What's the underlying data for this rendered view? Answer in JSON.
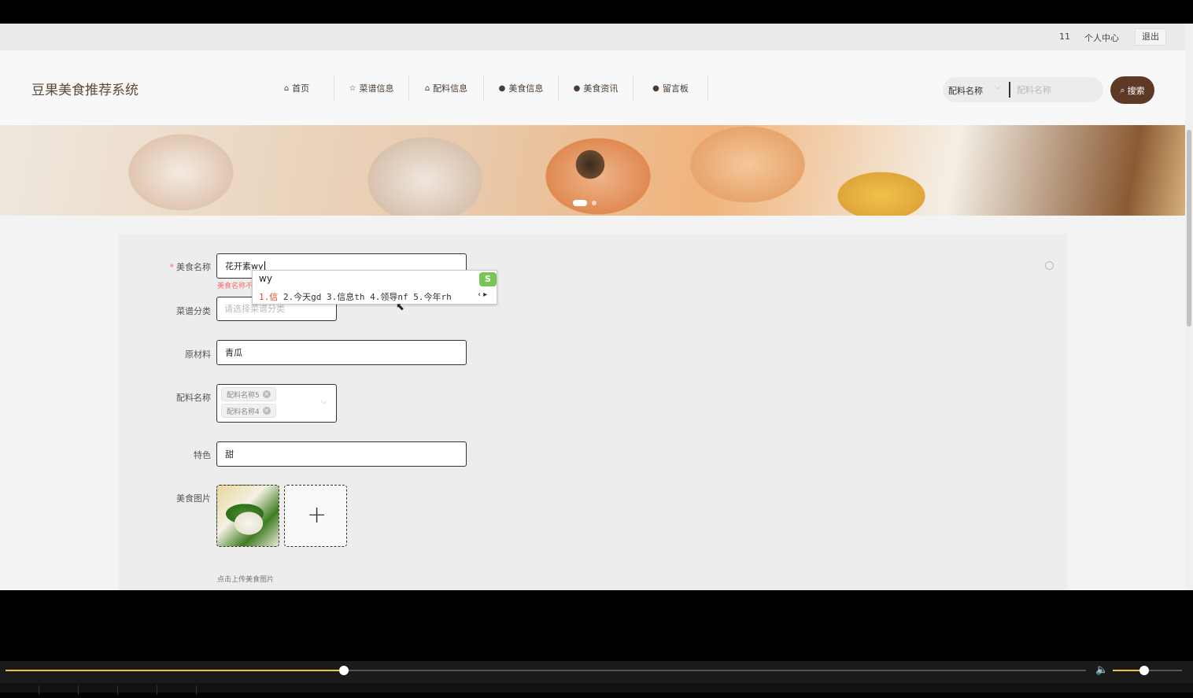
{
  "topbar": {
    "user": "11",
    "profile": "个人中心",
    "logout": "退出"
  },
  "brand": "豆果美食推荐系统",
  "nav": [
    {
      "icon": "⌂",
      "label": "首页"
    },
    {
      "icon": "☆",
      "label": "菜谱信息"
    },
    {
      "icon": "⌂",
      "label": "配料信息"
    },
    {
      "icon": "●",
      "label": "美食信息"
    },
    {
      "icon": "●",
      "label": "美食资讯"
    },
    {
      "icon": "●",
      "label": "留言板"
    }
  ],
  "search": {
    "field": "配料名称",
    "placeholder": "配料名称",
    "button": "搜索"
  },
  "form": {
    "name": {
      "label": "美食名称",
      "value": "花开素wy",
      "error": "美食名称不"
    },
    "category": {
      "label": "菜谱分类",
      "placeholder": "请选择菜谱分类"
    },
    "ingredients": {
      "label": "原材料",
      "value": "青瓜"
    },
    "seasoning": {
      "label": "配料名称",
      "tags": [
        "配料名称5",
        "配料名称4"
      ]
    },
    "feature": {
      "label": "特色",
      "value": "甜"
    },
    "image": {
      "label": "美食图片",
      "hint": "点击上传美食图片"
    }
  },
  "ime": {
    "composition": "wy",
    "candidates": [
      "1.信",
      "2.今天gd",
      "3.信息th",
      "4.领导nf",
      "5.今年rh"
    ]
  },
  "player": {
    "progress": 0.313,
    "volume": 0.45
  }
}
